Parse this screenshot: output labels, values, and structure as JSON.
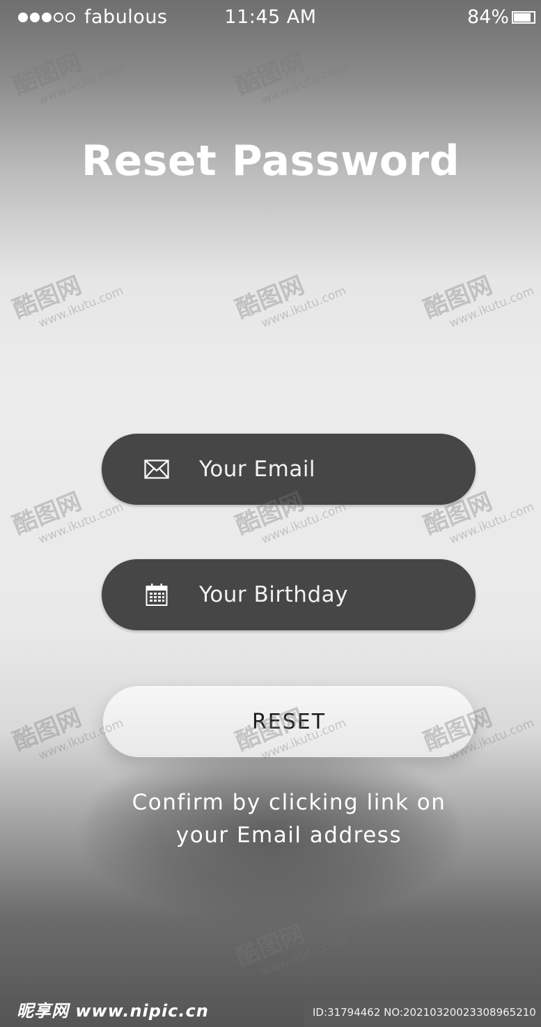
{
  "status_bar": {
    "carrier": "fabulous",
    "time": "11:45 AM",
    "battery": "84%"
  },
  "title": "Reset Password",
  "form": {
    "email": {
      "placeholder": "Your Email",
      "value": "",
      "icon": "envelope-icon"
    },
    "birthday": {
      "placeholder": "Your Birthday",
      "value": "",
      "icon": "calendar-icon"
    },
    "reset_label": "RESET",
    "confirm_line1": "Confirm by clicking link on",
    "confirm_line2": "your Email address"
  },
  "watermark": {
    "brand": "酷图网",
    "url": "www.ikutu.com"
  },
  "footer": {
    "logo": "昵享网 www.nipic.cn",
    "id_text": "ID:31794462 NO:20210320023308965210"
  },
  "colors": {
    "field_background": "#464646",
    "button_background": "#f2f2f2",
    "text_primary": "#ffffff"
  }
}
